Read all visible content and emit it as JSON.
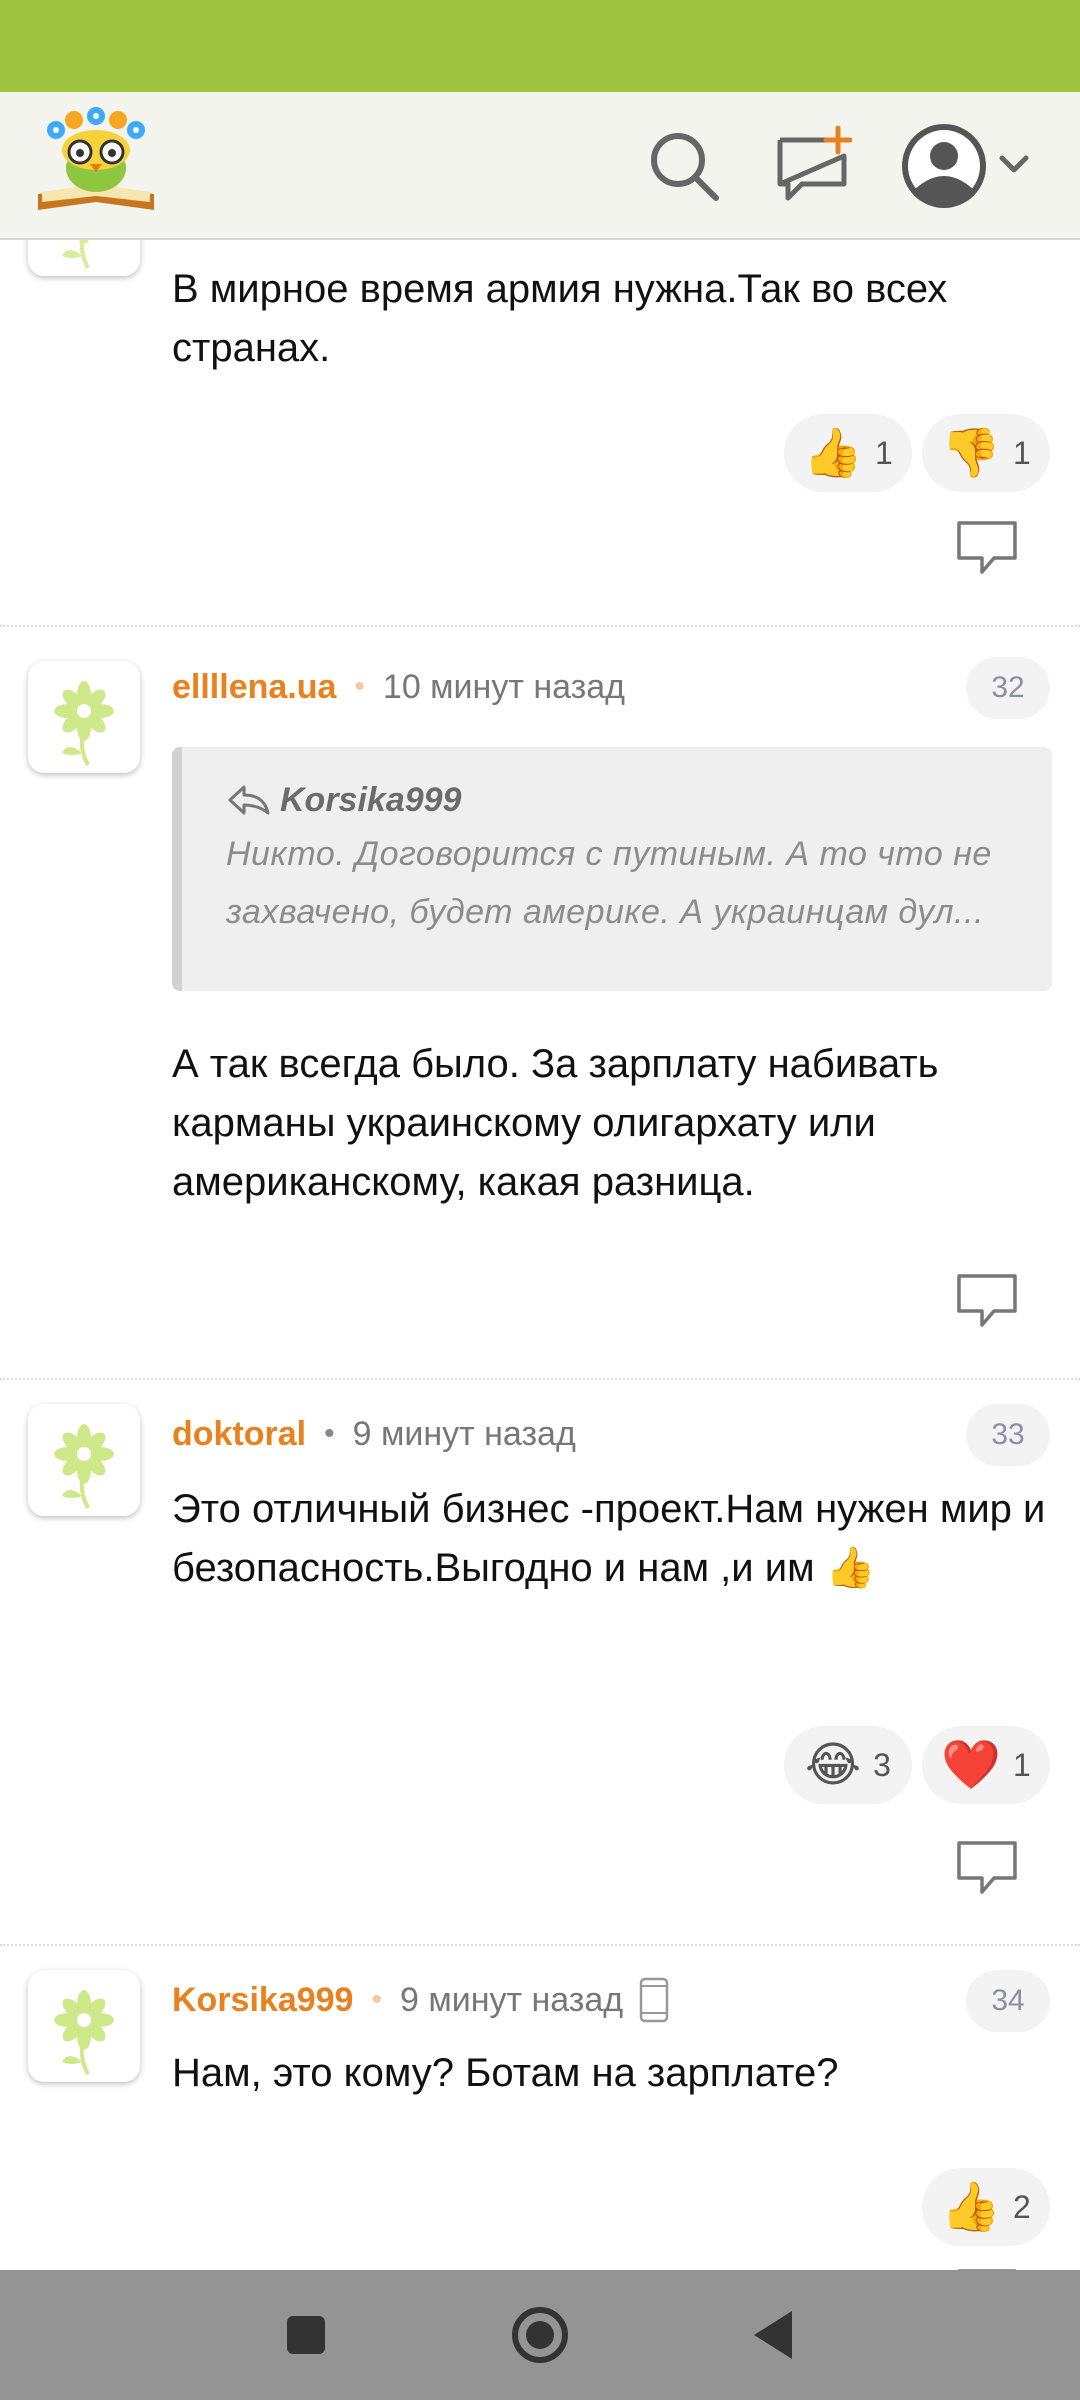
{
  "header": {
    "logo": "owl-with-flowers-on-book-logo",
    "icons": [
      "search-icon",
      "new-post-icon",
      "account-icon",
      "chevron-down-icon"
    ]
  },
  "colors": {
    "status_bar": "#9dc33f",
    "author": "#e9821e",
    "header_bg": "#f4f4ef"
  },
  "comments": [
    {
      "text": "В мирное время армия нужна.Так во всех странах.",
      "reactions": [
        {
          "emoji": "👍",
          "count": "1"
        },
        {
          "emoji": "👎",
          "count": "1"
        }
      ]
    },
    {
      "author": "ellllena.ua",
      "time": "10 минут назад",
      "number": "32",
      "quote": {
        "author": "Korsika999",
        "text": "Никто. Договорится с путиным. А то что не захвачено, будет америке. А украинцам дул..."
      },
      "text": "А так всегда было. За зарплату набивать карманы украинскому олигархату или американскому, какая разница."
    },
    {
      "author": "doktoral",
      "time": "9 минут назад",
      "number": "33",
      "text": "Это отличный бизнес -проект.Нам нужен мир и безопасность.Выгодно и нам ,и им 👍",
      "reactions": [
        {
          "emoji": "😂",
          "count": "3"
        },
        {
          "emoji": "❤️",
          "count": "1"
        }
      ]
    },
    {
      "author": "Korsika999",
      "time": "9 минут назад",
      "device": "mobile-phone-icon",
      "number": "34",
      "text": "Нам, это кому? Ботам на зарплате?",
      "reactions": [
        {
          "emoji": "👍",
          "count": "2"
        }
      ]
    }
  ],
  "navigation": [
    "recents-button",
    "home-button",
    "back-button"
  ]
}
